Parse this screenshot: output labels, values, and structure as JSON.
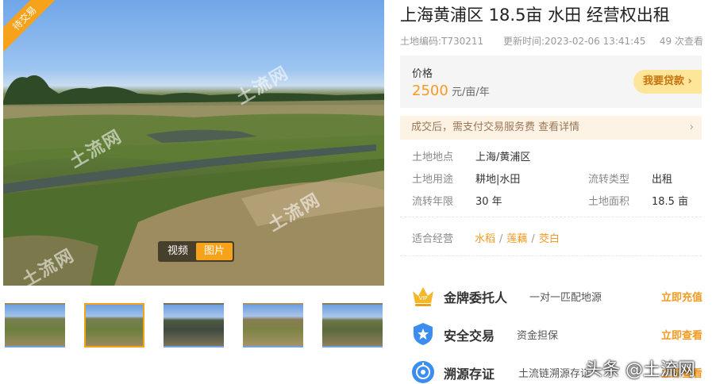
{
  "gallery": {
    "ribbon_label": "待交易",
    "watermarks": [
      "土流网",
      "土流网",
      "土流网",
      "土流网"
    ],
    "media_tabs": [
      {
        "label": "视频",
        "active": false
      },
      {
        "label": "图片",
        "active": true
      }
    ],
    "thumbnails": [
      {
        "selected": false
      },
      {
        "selected": true
      },
      {
        "selected": false
      },
      {
        "selected": false
      },
      {
        "selected": false
      }
    ]
  },
  "listing": {
    "title": "上海黄浦区 18.5亩 水田 经营权出租",
    "code": "土地编码:T730211",
    "updated": "更新时间:2023-02-06 13:41:45",
    "views": "49 次查看"
  },
  "price": {
    "label": "价格",
    "value": "2500",
    "unit": " 元/亩/年",
    "loan_button": "我要贷款 ›"
  },
  "fee_notice": {
    "text": "成交后，需支付交易服务费 查看详情",
    "chevron": "›"
  },
  "details": {
    "location": {
      "key": "土地地点",
      "value": "上海/黄浦区"
    },
    "usage": {
      "key": "土地用途",
      "value": "耕地|水田"
    },
    "transfer_type": {
      "key": "流转类型",
      "value": "出租"
    },
    "term": {
      "key": "流转年限",
      "value": "30 年"
    },
    "area": {
      "key": "土地面积",
      "value": "18.5 亩"
    }
  },
  "suitable": {
    "label": "适合经营",
    "tags": [
      "水稻",
      "莲藕",
      "茭白"
    ],
    "separator": "/"
  },
  "services": [
    {
      "icon": "crown-icon",
      "name": "金牌委托人",
      "desc": "一对一匹配地源",
      "action": "立即充值"
    },
    {
      "icon": "shield-icon",
      "name": "安全交易",
      "desc": "资金担保",
      "action": "立即查看"
    },
    {
      "icon": "trace-icon",
      "name": "溯源存证",
      "desc": "土流链溯源存证",
      "action": "立即查看"
    }
  ],
  "brand_watermark": "头条 @土流网",
  "colors": {
    "accent": "#f59a23",
    "ribbon": "#f7a21b",
    "loan_bg": "#fde59a",
    "fee_bg": "#fdf3e5",
    "price_bg": "#f5f5f5"
  }
}
